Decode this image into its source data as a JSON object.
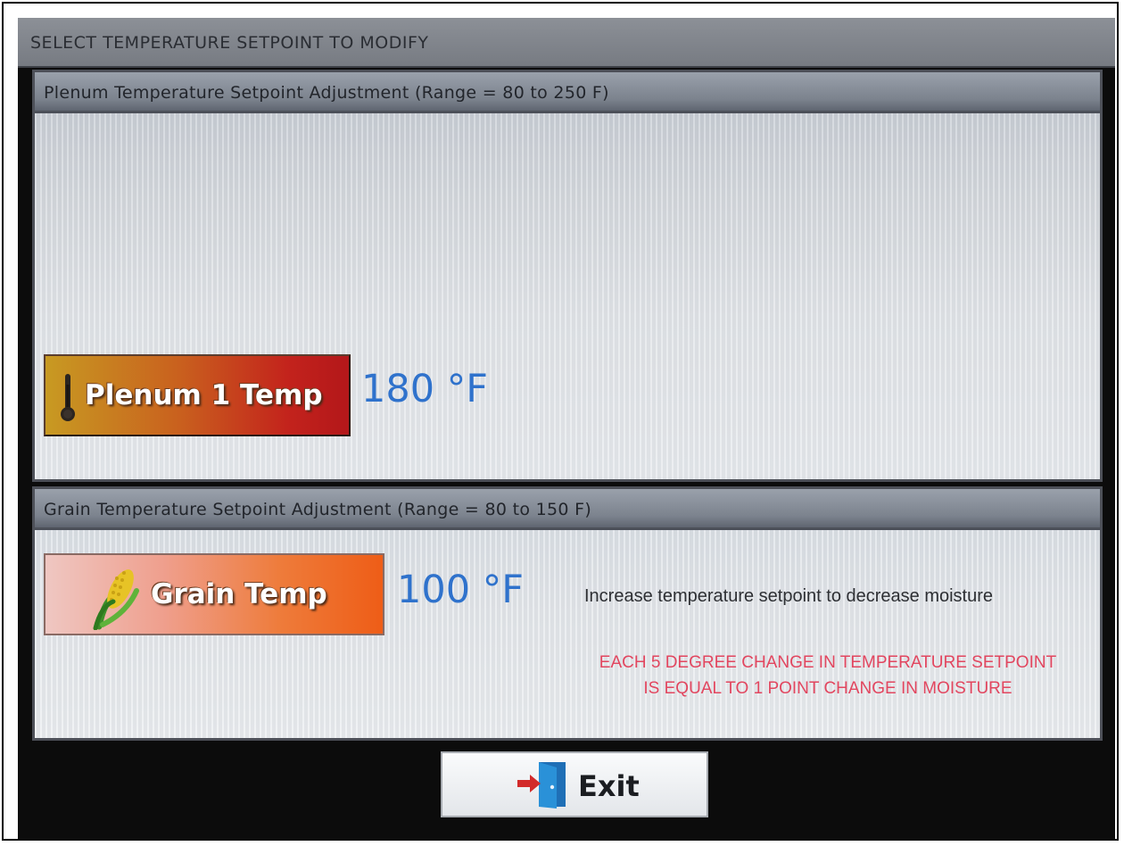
{
  "screen": {
    "title": "SELECT TEMPERATURE SETPOINT TO MODIFY"
  },
  "plenum": {
    "header": "Plenum Temperature Setpoint Adjustment (Range = 80 to 250 F)",
    "button_label": "Plenum 1 Temp",
    "button_icon": "thermometer-icon",
    "value": "180 °F"
  },
  "grain": {
    "header": "Grain Temperature Setpoint Adjustment (Range = 80 to 150 F)",
    "button_label": "Grain Temp",
    "button_icon": "corn-icon",
    "value": "100 °F",
    "hint": "Increase temperature setpoint to decrease moisture",
    "warning_line1": "EACH 5 DEGREE CHANGE IN TEMPERATURE SETPOINT",
    "warning_line2": "IS EQUAL TO 1 POINT CHANGE IN MOISTURE"
  },
  "footer": {
    "exit_label": "Exit",
    "exit_icon": "exit-door-icon"
  },
  "colors": {
    "value_blue": "#2f72cc",
    "warning_red": "#e2465f"
  }
}
